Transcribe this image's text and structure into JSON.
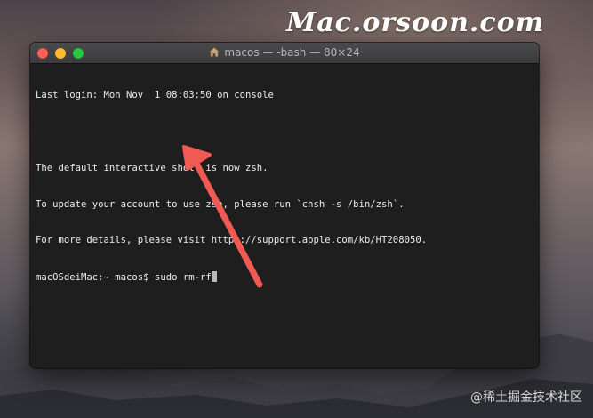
{
  "watermarks": {
    "top": "Mac.orsoon.com",
    "bottom": "@稀土掘金技术社区"
  },
  "window": {
    "title": "macos — -bash — 80×24",
    "title_icon": "home-icon"
  },
  "terminal": {
    "lines": [
      "Last login: Mon Nov  1 08:03:50 on console",
      "",
      "The default interactive shell is now zsh.",
      "To update your account to use zsh, please run `chsh -s /bin/zsh`.",
      "For more details, please visit https://support.apple.com/kb/HT208050."
    ],
    "prompt": "macOSdeiMac:~ macos$ ",
    "command": "sudo rm-rf"
  },
  "colors": {
    "arrow": "#f05a52",
    "terminal_bg": "#1e1e1e",
    "terminal_text": "#ececec",
    "close": "#ff5f57",
    "minimize": "#febc2e",
    "zoom": "#28c840"
  }
}
